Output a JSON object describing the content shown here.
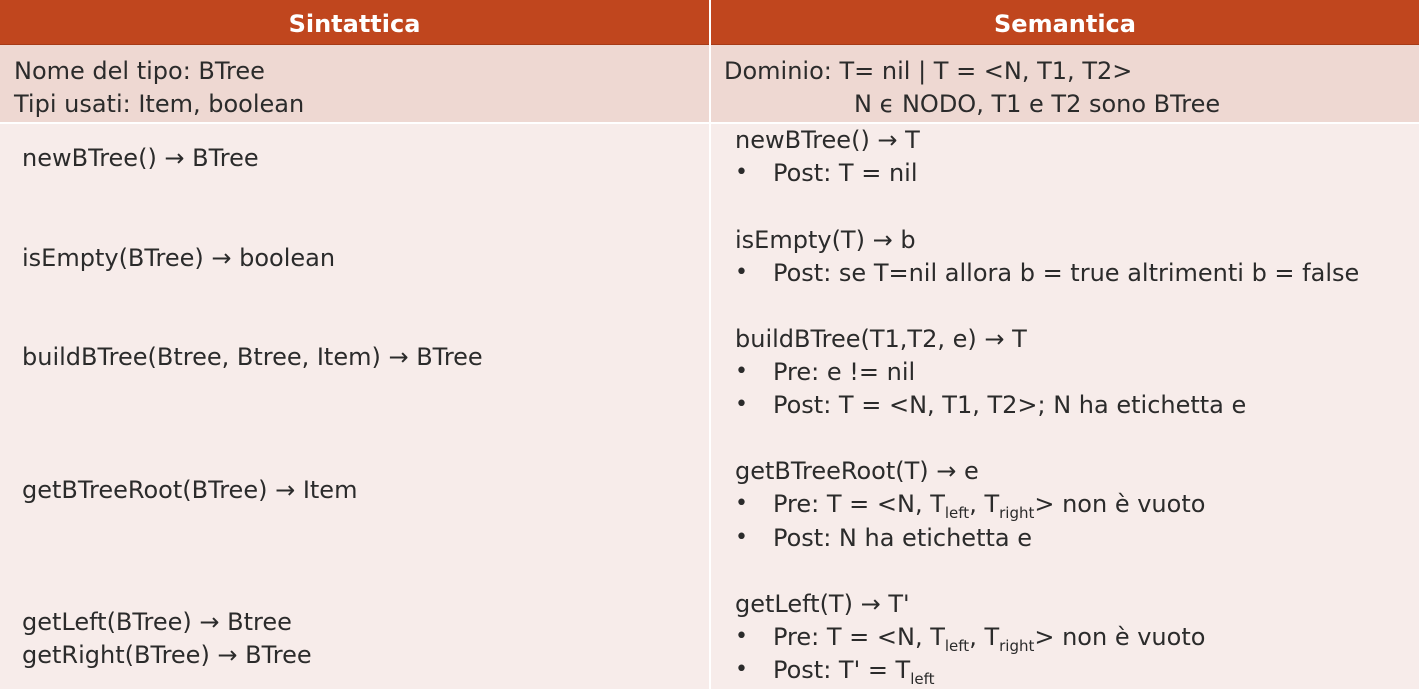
{
  "header": {
    "left": "Sintattica",
    "right": "Semantica"
  },
  "type_row": {
    "left_line1": "Nome del tipo:   BTree",
    "left_line2": "Tipi  usati:  Item, boolean",
    "right_line1": "Dominio:  T= nil  |   T = <N, T1, T2>",
    "right_line2": "N ϵ NODO, T1 e T2 sono BTree"
  },
  "operations": [
    {
      "syntax": "newBTree() → BTree",
      "signature": "newBTree() → T",
      "post": "Post: T = nil"
    },
    {
      "syntax": "isEmpty(BTree) → boolean",
      "signature": "isEmpty(T) → b",
      "post": "Post: se T=nil allora b = true altrimenti b = false"
    },
    {
      "syntax": "buildBTree(Btree, Btree, Item) → BTree",
      "signature": "buildBTree(T1,T2, e) → T",
      "pre": "Pre: e != nil",
      "post": "Post: T = <N, T1, T2>; N ha etichetta e"
    },
    {
      "syntax": "getBTreeRoot(BTree) → Item",
      "signature": "getBTreeRoot(T) → e",
      "pre_a": "Pre: T = <N, T",
      "pre_sub1": "left",
      "pre_b": ", T",
      "pre_sub2": "right",
      "pre_c": ">   non è vuoto",
      "post": "Post: N ha etichetta e"
    },
    {
      "syntax_line1": "getLeft(BTree) → Btree",
      "syntax_line2": "getRight(BTree) → BTree",
      "signature": "getLeft(T) → T'",
      "pre_a": "Pre: T = <N, T",
      "pre_sub1": "left",
      "pre_b": ", T",
      "pre_sub2": "right",
      "pre_c": ">   non è vuoto",
      "post_a": "Post: T' = T",
      "post_sub": "left"
    }
  ],
  "bullet": "•",
  "colors": {
    "header_bg": "#c0461e",
    "type_row_bg": "#eed8d2",
    "body_bg": "#f7ecea"
  }
}
